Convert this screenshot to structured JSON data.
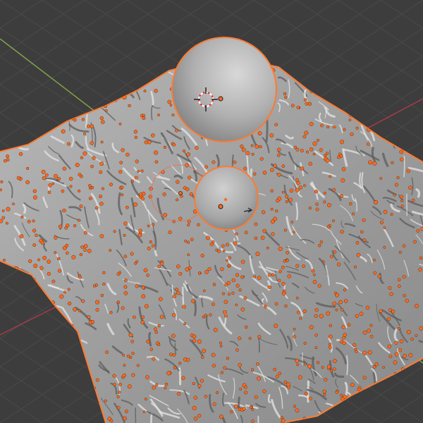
{
  "viewport": {
    "kind": "3d-viewport",
    "background_color": "#3d3d3d",
    "grid_color": "#4a4a4a",
    "x_axis_color": "#a83a4a",
    "y_axis_color": "#7fa14a"
  },
  "scene": {
    "terrain": {
      "name": "displaced-plane",
      "surface_color": "#a8a8a8",
      "selected": true,
      "selection_outline_color": "#ff7a30",
      "vertex_dot_color": "#ff6a1e"
    },
    "spheres": [
      {
        "name": "large-sphere",
        "selected": true,
        "color": "#b9b9b9"
      },
      {
        "name": "medium-sphere",
        "selected": true,
        "color": "#b3b3b3"
      },
      {
        "name": "ghost-sphere",
        "selected": false,
        "color": "#9a9a9a"
      }
    ],
    "cursor_3d": {
      "icon": "3d-cursor-icon"
    },
    "light_gizmo": {
      "icon": "arrow-icon"
    }
  }
}
